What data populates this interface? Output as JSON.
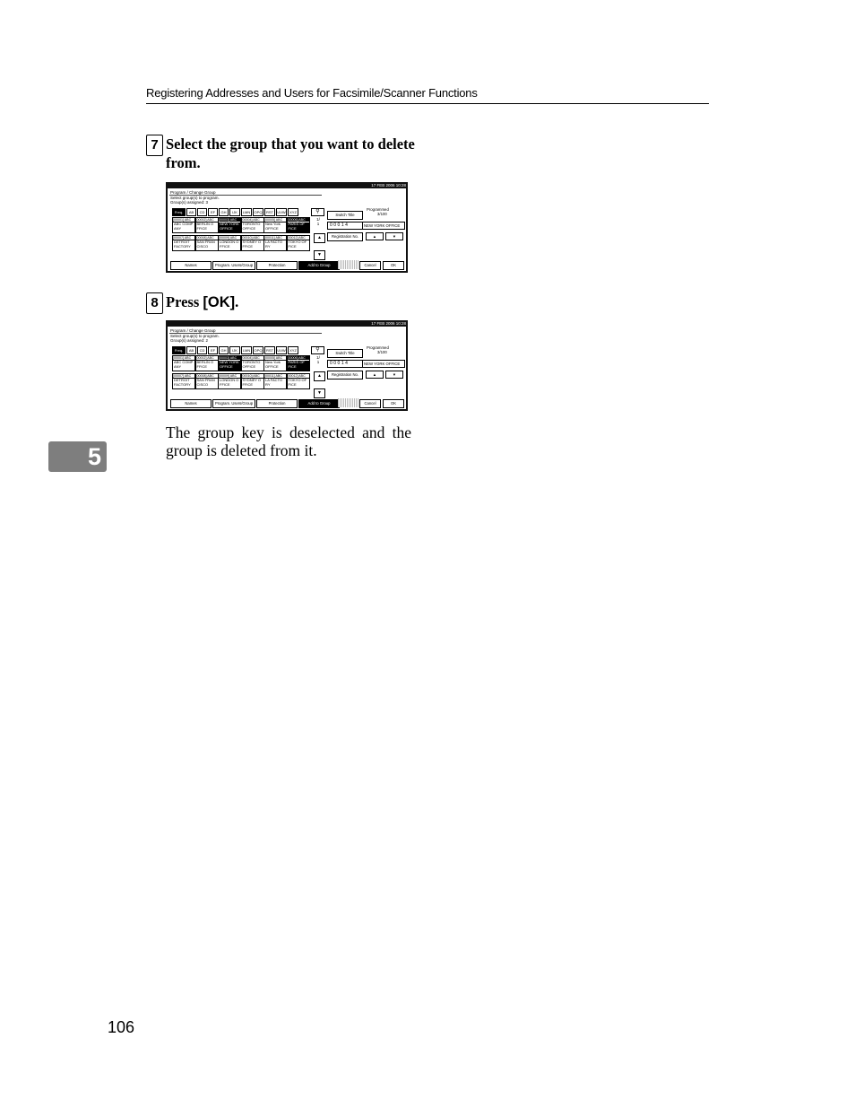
{
  "header": "Registering Addresses and Users for Facsimile/Scanner Functions",
  "steps": [
    {
      "num": "7",
      "text": "Select the group that you want to delete from."
    },
    {
      "num": "8",
      "pre": "Press ",
      "key": "[OK]",
      "post": "."
    }
  ],
  "result_text": "The group key is deselected and the group is deleted from it.",
  "chapter": "5",
  "page_number": "106",
  "screens": [
    {
      "datetime": "17  FEB   2006 10:28",
      "title": "Program / Change Group",
      "instruction": "Select group(s) to program.",
      "assigned": "Group(s) assigned:  3",
      "tabs": [
        "Freq.",
        "AB",
        "CD",
        "EF",
        "GH",
        "IJK",
        "LMN",
        "OPQ",
        "RST",
        "UVW",
        "XYZ"
      ],
      "page_indicator": [
        "1/",
        "1"
      ],
      "groups": [
        {
          "code": "[00001] ABC",
          "line1": "ABC COMP",
          "line2": "ANY",
          "selected": false
        },
        {
          "code": "[00002] ABC",
          "line1": "BERLIN O",
          "line2": "FFICE",
          "selected": false
        },
        {
          "code": "[00003] ABC",
          "line1": "NEW YORK",
          "line2": "OFFICE",
          "selected": true
        },
        {
          "code": "[00004] ABC",
          "line1": "TORONTO",
          "line2": "OFFICE",
          "selected": false
        },
        {
          "code": "[00005] ABC",
          "line1": "New York",
          "line2": "OFFICE",
          "selected": false
        },
        {
          "code": "[00006] ABC",
          "line1": "PARIS OF",
          "line2": "FICE",
          "selected": true
        },
        {
          "code": "[00007] ABC",
          "line1": "DETROIT",
          "line2": "FACTORY",
          "selected": false
        },
        {
          "code": "[00008] ABC",
          "line1": "SAN FRAN",
          "line2": "CISCO",
          "selected": false
        },
        {
          "code": "[00009] ABC",
          "line1": "LONDON O",
          "line2": "FFICE",
          "selected": false
        },
        {
          "code": "[00010] ABC",
          "line1": "SYDNEY O",
          "line2": "FFICE",
          "selected": false
        },
        {
          "code": "[00011] ABC",
          "line1": "LA FACTO",
          "line2": "RY",
          "selected": false
        },
        {
          "code": "[00012] ABC",
          "line1": "TOKYO OF",
          "line2": "FICE",
          "selected": false
        }
      ],
      "switch_title": "Switch Title",
      "programmed_label": "Programmed",
      "programmed_count": "3/100",
      "reg_no": "00014",
      "name_value": "NEW YORK OFFICE",
      "registration_no": "Registration No.",
      "up": "▲",
      "down": "▼",
      "bottom_tabs": [
        "Names",
        "Program. Users/Group",
        "Protection",
        "Add to Group"
      ],
      "cancel": "Cancel",
      "ok": "OK"
    },
    {
      "datetime": "17  FEB   2006 10:28",
      "title": "Program / Change Group",
      "instruction": "Select group(s) to program.",
      "assigned": "Group(s) assigned:  2",
      "tabs": [
        "Freq.",
        "AB",
        "CD",
        "EF",
        "GH",
        "IJK",
        "LMN",
        "OPQ",
        "RST",
        "UVW",
        "XYZ"
      ],
      "page_indicator": [
        "1/",
        "1"
      ],
      "groups": [
        {
          "code": "[00001] ABC",
          "line1": "ABC COMP",
          "line2": "ANY",
          "selected": false
        },
        {
          "code": "[00002] ABC",
          "line1": "BERLIN O",
          "line2": "FFICE",
          "selected": false
        },
        {
          "code": "[00003] ABC",
          "line1": "NEW YORK",
          "line2": "OFFICE",
          "selected": true
        },
        {
          "code": "[00004] ABC",
          "line1": "TORONTO",
          "line2": "OFFICE",
          "selected": false
        },
        {
          "code": "[00005] ABC",
          "line1": "New York",
          "line2": "OFFICE",
          "selected": false
        },
        {
          "code": "[00006] ABC",
          "line1": "PARIS OF",
          "line2": "FICE",
          "selected": true
        },
        {
          "code": "[00007] ABC",
          "line1": "DETROIT",
          "line2": "FACTORY",
          "selected": false
        },
        {
          "code": "[00008] ABC",
          "line1": "SAN FRAN",
          "line2": "CISCO",
          "selected": false
        },
        {
          "code": "[00009] ABC",
          "line1": "LONDON O",
          "line2": "FFICE",
          "selected": false
        },
        {
          "code": "[00010] ABC",
          "line1": "SYDNEY O",
          "line2": "FFICE",
          "selected": false
        },
        {
          "code": "[00011] ABC",
          "line1": "LA FACTO",
          "line2": "RY",
          "selected": false
        },
        {
          "code": "[00012] ABC",
          "line1": "TOKYO OF",
          "line2": "FICE",
          "selected": false
        }
      ],
      "switch_title": "Switch Title",
      "programmed_label": "Programmed",
      "programmed_count": "3/100",
      "reg_no": "00014",
      "name_value": "NEW YORK OFFICE",
      "registration_no": "Registration No.",
      "up": "▲",
      "down": "▼",
      "bottom_tabs": [
        "Names",
        "Program. Users/Group",
        "Protection",
        "Add to Group"
      ],
      "cancel": "Cancel",
      "ok": "OK"
    }
  ]
}
